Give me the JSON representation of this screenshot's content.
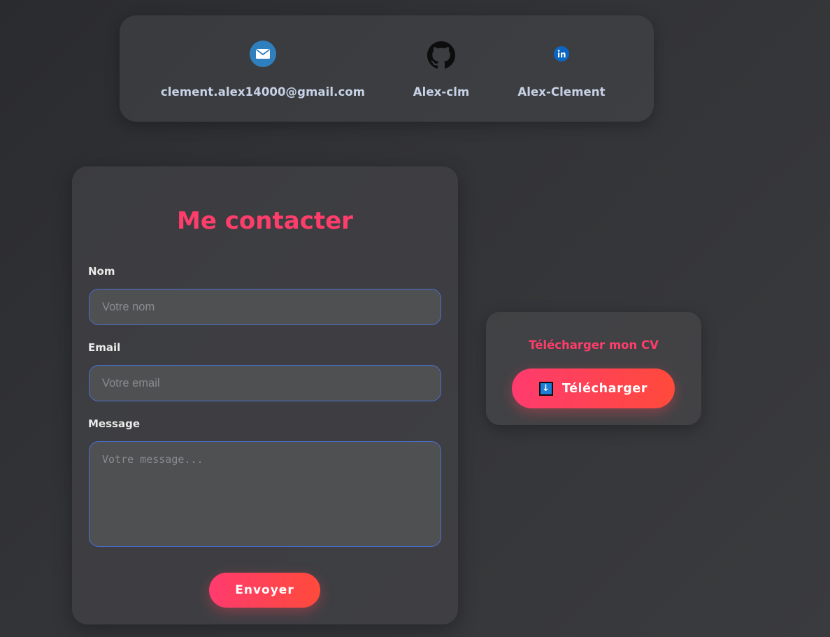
{
  "contacts": {
    "email": {
      "text": "clement.alex14000@gmail.com",
      "icon": "email-icon"
    },
    "github": {
      "text": "Alex-clm",
      "icon": "github-icon"
    },
    "linkedin": {
      "text": "Alex-Clement",
      "icon": "linkedin-icon"
    }
  },
  "form": {
    "title": "Me contacter",
    "fields": {
      "name": {
        "label": "Nom",
        "placeholder": "Votre nom"
      },
      "email": {
        "label": "Email",
        "placeholder": "Votre email"
      },
      "message": {
        "label": "Message",
        "placeholder": "Votre message..."
      }
    },
    "submit_label": "Envoyer"
  },
  "cv": {
    "title": "Télécharger mon CV",
    "button_label": "Télécharger",
    "button_icon": "download-arrow-icon"
  },
  "colors": {
    "accent": "#ff3d6b",
    "accent_gradient_end": "#ff4a3b",
    "input_border": "#4a6fd0",
    "link_text": "#c8d2e6"
  }
}
